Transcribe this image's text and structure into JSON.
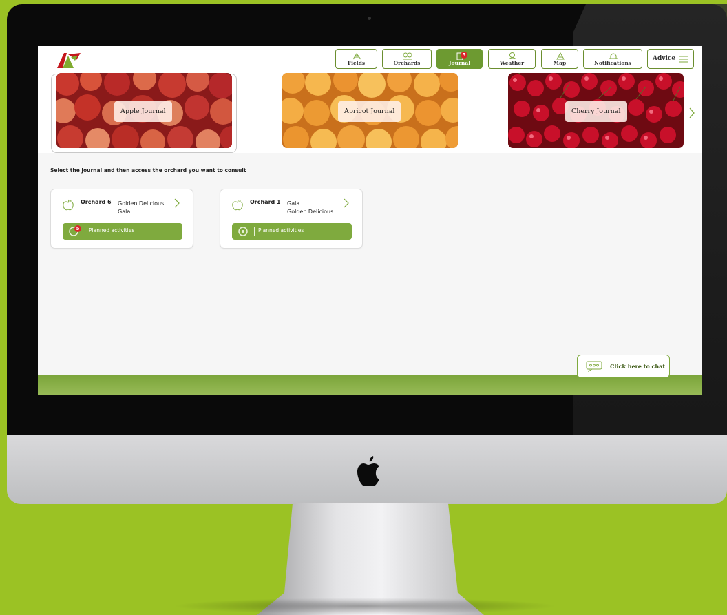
{
  "nav": [
    {
      "label": "Fields",
      "icon": "fields-icon"
    },
    {
      "label": "Orchards",
      "icon": "orchards-icon"
    },
    {
      "label": "Journal",
      "icon": "journal-icon",
      "badge": "5",
      "active": true
    },
    {
      "label": "Weather",
      "icon": "weather-icon"
    },
    {
      "label": "Map",
      "icon": "map-icon"
    },
    {
      "label": "Notifications",
      "icon": "notifications-icon"
    }
  ],
  "advice": {
    "label": "Advice",
    "icon": "hamburger-menu-icon"
  },
  "journals": [
    {
      "label": "Apple Journal",
      "selected": true
    },
    {
      "label": "Apricot Journal"
    },
    {
      "label": "Cherry Journal"
    }
  ],
  "instruction": "Select the journal and then access the orchard you want to consult",
  "orchards": [
    {
      "name": "Orchard 6",
      "varieties": [
        "Golden Delicious",
        "Gala"
      ],
      "planned": "Planned activities",
      "badge": "5"
    },
    {
      "name": "Orchard 1",
      "varieties": [
        "Gala",
        "Golden Delicious"
      ],
      "planned": "Planned activities"
    }
  ],
  "chat": {
    "label": "Click here to chat"
  },
  "colors": {
    "accent": "#6d9a31",
    "background": "#9bc224",
    "badge": "#d9262a"
  }
}
